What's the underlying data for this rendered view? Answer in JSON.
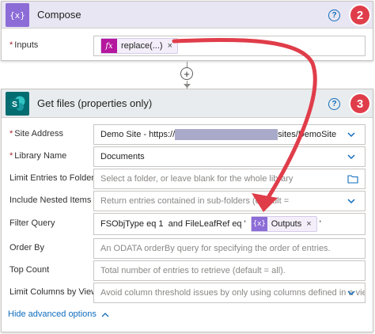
{
  "compose": {
    "title": "Compose",
    "badge": "2",
    "help": "?",
    "inputs_label": "Inputs",
    "token": {
      "label": "replace(...)",
      "icon": "fx-icon",
      "close": "×"
    }
  },
  "getfiles": {
    "title": "Get files (properties only)",
    "badge": "3",
    "help": "?",
    "fields": {
      "site_address": {
        "label": "Site Address",
        "value_prefix": "Demo Site - https://",
        "value_suffix": "sites/DemoSite"
      },
      "library_name": {
        "label": "Library Name",
        "value": "Documents"
      },
      "limit_folder": {
        "label": "Limit Entries to Folder",
        "placeholder": "Select a folder, or leave blank for the whole library"
      },
      "nested_items": {
        "label": "Include Nested Items",
        "placeholder": "Return entries contained in sub-folders (default = "
      },
      "filter_query": {
        "label": "Filter Query",
        "value": "FSObjType eq 1  and FileLeafRef eq '",
        "token": "Outputs",
        "token_close": "×",
        "suffix": "'"
      },
      "order_by": {
        "label": "Order By",
        "placeholder": "An ODATA orderBy query for specifying the order of entries."
      },
      "top_count": {
        "label": "Top Count",
        "placeholder": "Total number of entries to retrieve (default = all)."
      },
      "limit_columns": {
        "label": "Limit Columns by View",
        "placeholder": "Avoid column threshold issues by only using columns defined in a view"
      }
    },
    "advanced_link": "Hide advanced options"
  },
  "required_mark": "*",
  "colors": {
    "accent": "#0f6cbd",
    "badge": "#e03d4a",
    "compose_icon": "#8c6cd6",
    "sharepoint_icon": "#036c70",
    "arrow": "#e03d4a"
  }
}
